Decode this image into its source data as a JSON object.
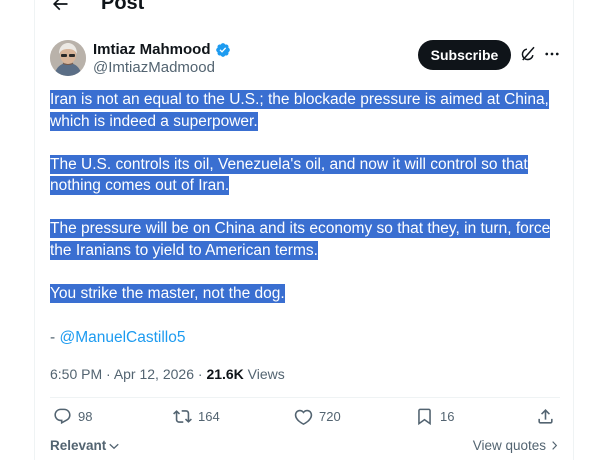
{
  "header": {
    "title": "Post"
  },
  "author": {
    "name": "Imtiaz Mahmood",
    "handle": "@ImtiazMadmood",
    "verified_color": "#1d9bf0"
  },
  "subscribe_label": "Subscribe",
  "post": {
    "paragraphs": [
      [
        "Iran is not an equal to the U.S.; the blockade pressure is aimed at China,",
        "which is indeed a superpower."
      ],
      [
        "The U.S. controls its oil, Venezuela's oil, and now it will control so that",
        "nothing comes out of Iran."
      ],
      [
        "The pressure will be on China and its economy so that they, in turn, force",
        "the Iranians to yield to American terms."
      ],
      [
        "You strike the master, not the dog."
      ]
    ],
    "mention_prefix": "- ",
    "mention": "@ManuelCastillo5",
    "selection_color": "#3a6fd1"
  },
  "meta": {
    "time": "6:50 PM",
    "separator": " · ",
    "date": "Apr 12, 2026",
    "views_count": "21.6K",
    "views_label": " Views"
  },
  "actions": {
    "replies": "98",
    "reposts": "164",
    "likes": "720",
    "bookmarks": "16"
  },
  "footer": {
    "sort_label": "Relevant",
    "view_quotes_label": "View quotes"
  },
  "icons": [
    "back-arrow-icon",
    "verified-badge-icon",
    "grok-icon",
    "more-icon",
    "reply-icon",
    "repost-icon",
    "like-icon",
    "bookmark-icon",
    "share-icon",
    "chevron-down-icon",
    "chevron-right-icon"
  ]
}
